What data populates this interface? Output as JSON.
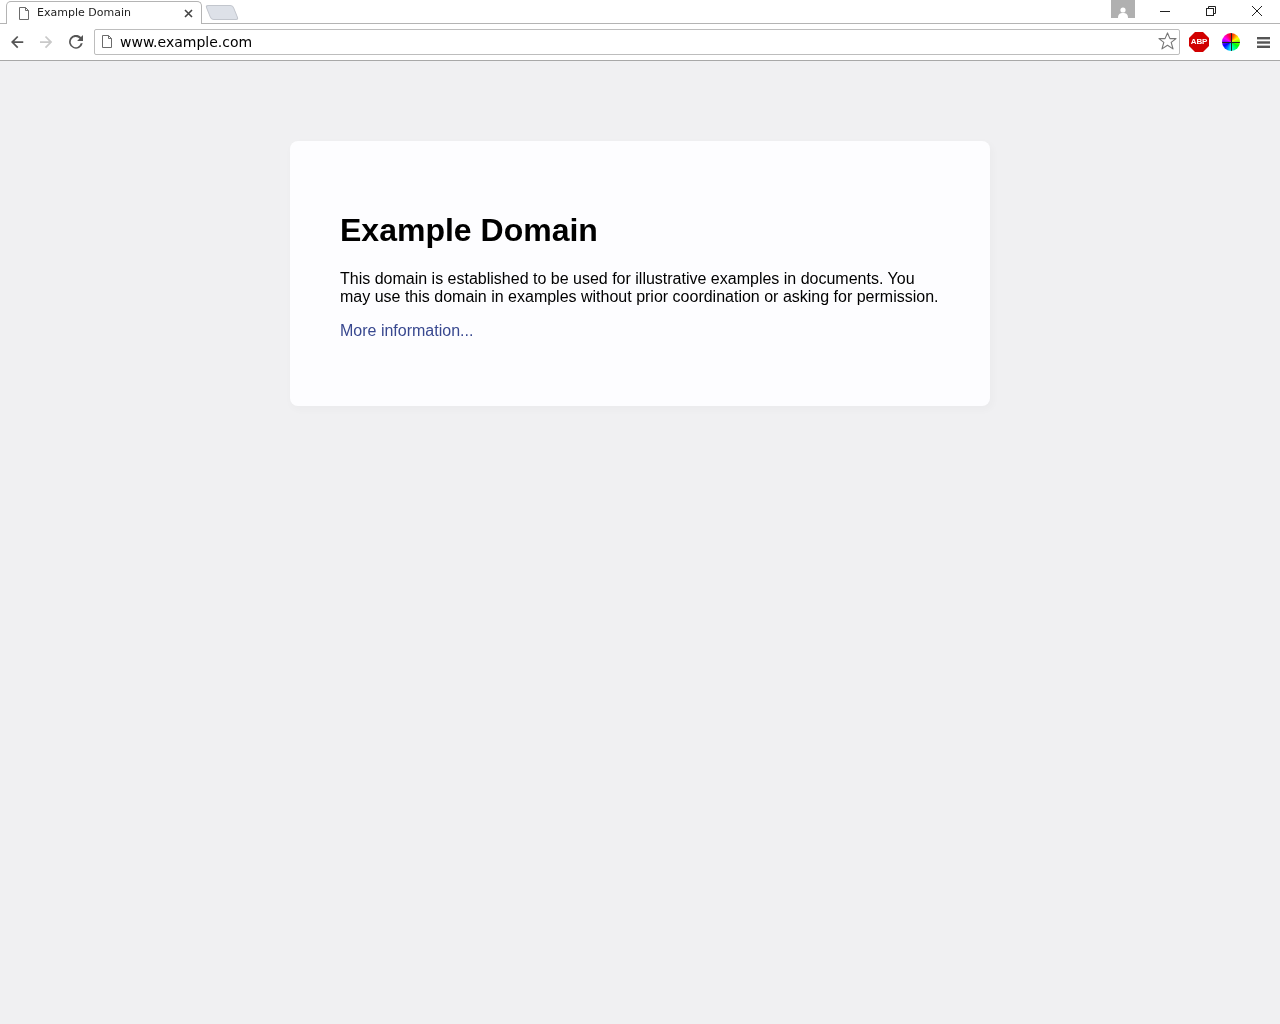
{
  "tabs": [
    {
      "title": "Example Domain",
      "selected": true
    }
  ],
  "toolbar": {
    "nav_buttons": [
      {
        "kind": "back",
        "disabled": false
      },
      {
        "kind": "forward",
        "disabled": true
      },
      {
        "kind": "reload",
        "disabled": false
      }
    ],
    "address": {
      "url": "www.example.com"
    },
    "extensions": [
      {
        "kind": "adblock",
        "label": "ABP"
      },
      {
        "kind": "color-picker"
      }
    ]
  },
  "page": {
    "heading": "Example Domain",
    "paragraph": "This domain is established to be used for illustrative examples in documents. You may use this domain in examples without prior coordination or asking for permission.",
    "link": "More information..."
  }
}
